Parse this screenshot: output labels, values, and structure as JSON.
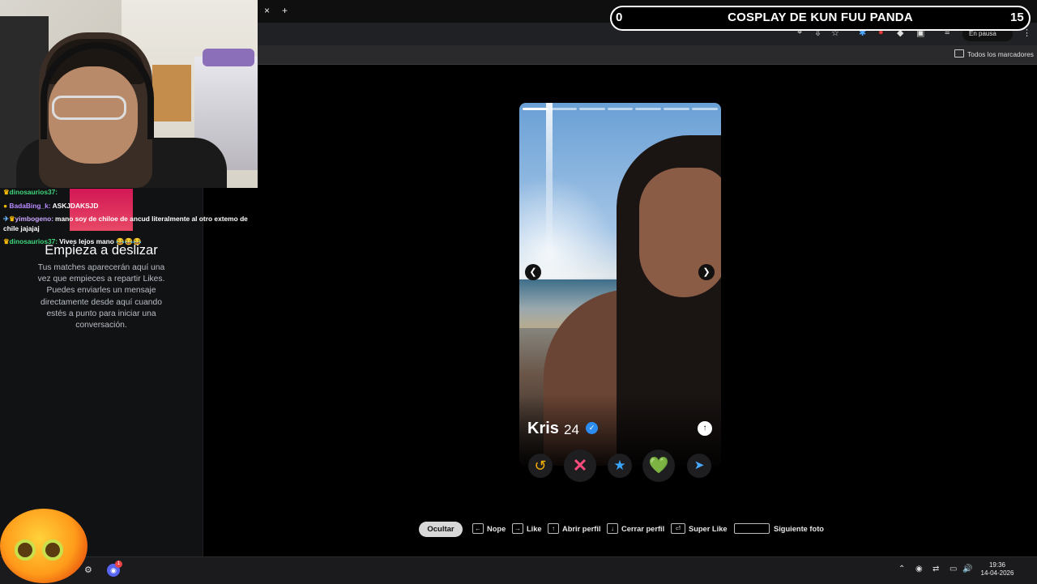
{
  "stream_overlay": {
    "left_count": "0",
    "title": "COSPLAY DE KUN FUU PANDA",
    "right_count": "15"
  },
  "browser": {
    "tab_close": "×",
    "tab_new": "+",
    "paused_label": "En pausa",
    "bookmarks_label": "Todos los marcadores"
  },
  "chat": {
    "messages": [
      {
        "user": "dinosaurios37:",
        "text": "",
        "user_color": "#3fd77c"
      },
      {
        "user": "BadaBing_k:",
        "text": "ASKJDAKSJD",
        "user_color": "#b98bff"
      },
      {
        "user": "yimbogeno:",
        "text": "mano soy de chiloe de ancud literalmente al otro extemo de chile jajajaj",
        "user_color": "#c9a7ff"
      },
      {
        "user": "dinosaurios37:",
        "text": "Vives lejos mano 😂😂😂",
        "user_color": "#3fd77c"
      }
    ]
  },
  "matches_panel": {
    "title": "Empieza a deslizar",
    "body": "Tus matches aparecerán aquí una vez que empieces a repartir Likes. Puedes enviarles un mensaje directamente desde aquí cuando estés a punto para iniciar una conversación."
  },
  "profile": {
    "name": "Kris",
    "age": "24",
    "photo_count": 7,
    "current_photo": 1
  },
  "actions": {
    "rewind_icon": "↺",
    "nope_icon": "✕",
    "super_icon": "★",
    "like_icon": "💚",
    "boost_icon": "➤"
  },
  "shortcuts": {
    "hide_label": "Ocultar",
    "nope": "Nope",
    "like": "Like",
    "open_profile": "Abrir perfil",
    "close_profile": "Cerrar perfil",
    "super_like": "Super Like",
    "next_photo": "Siguiente foto"
  },
  "taskbar": {
    "time": "19:36",
    "date": "14-04-2026",
    "discord_badge": "1"
  },
  "colors": {
    "nope": "#ff4b7d",
    "like": "#66e27a",
    "super": "#38a6ff",
    "rewind": "#f3b000",
    "verified": "#2d8cf0"
  }
}
